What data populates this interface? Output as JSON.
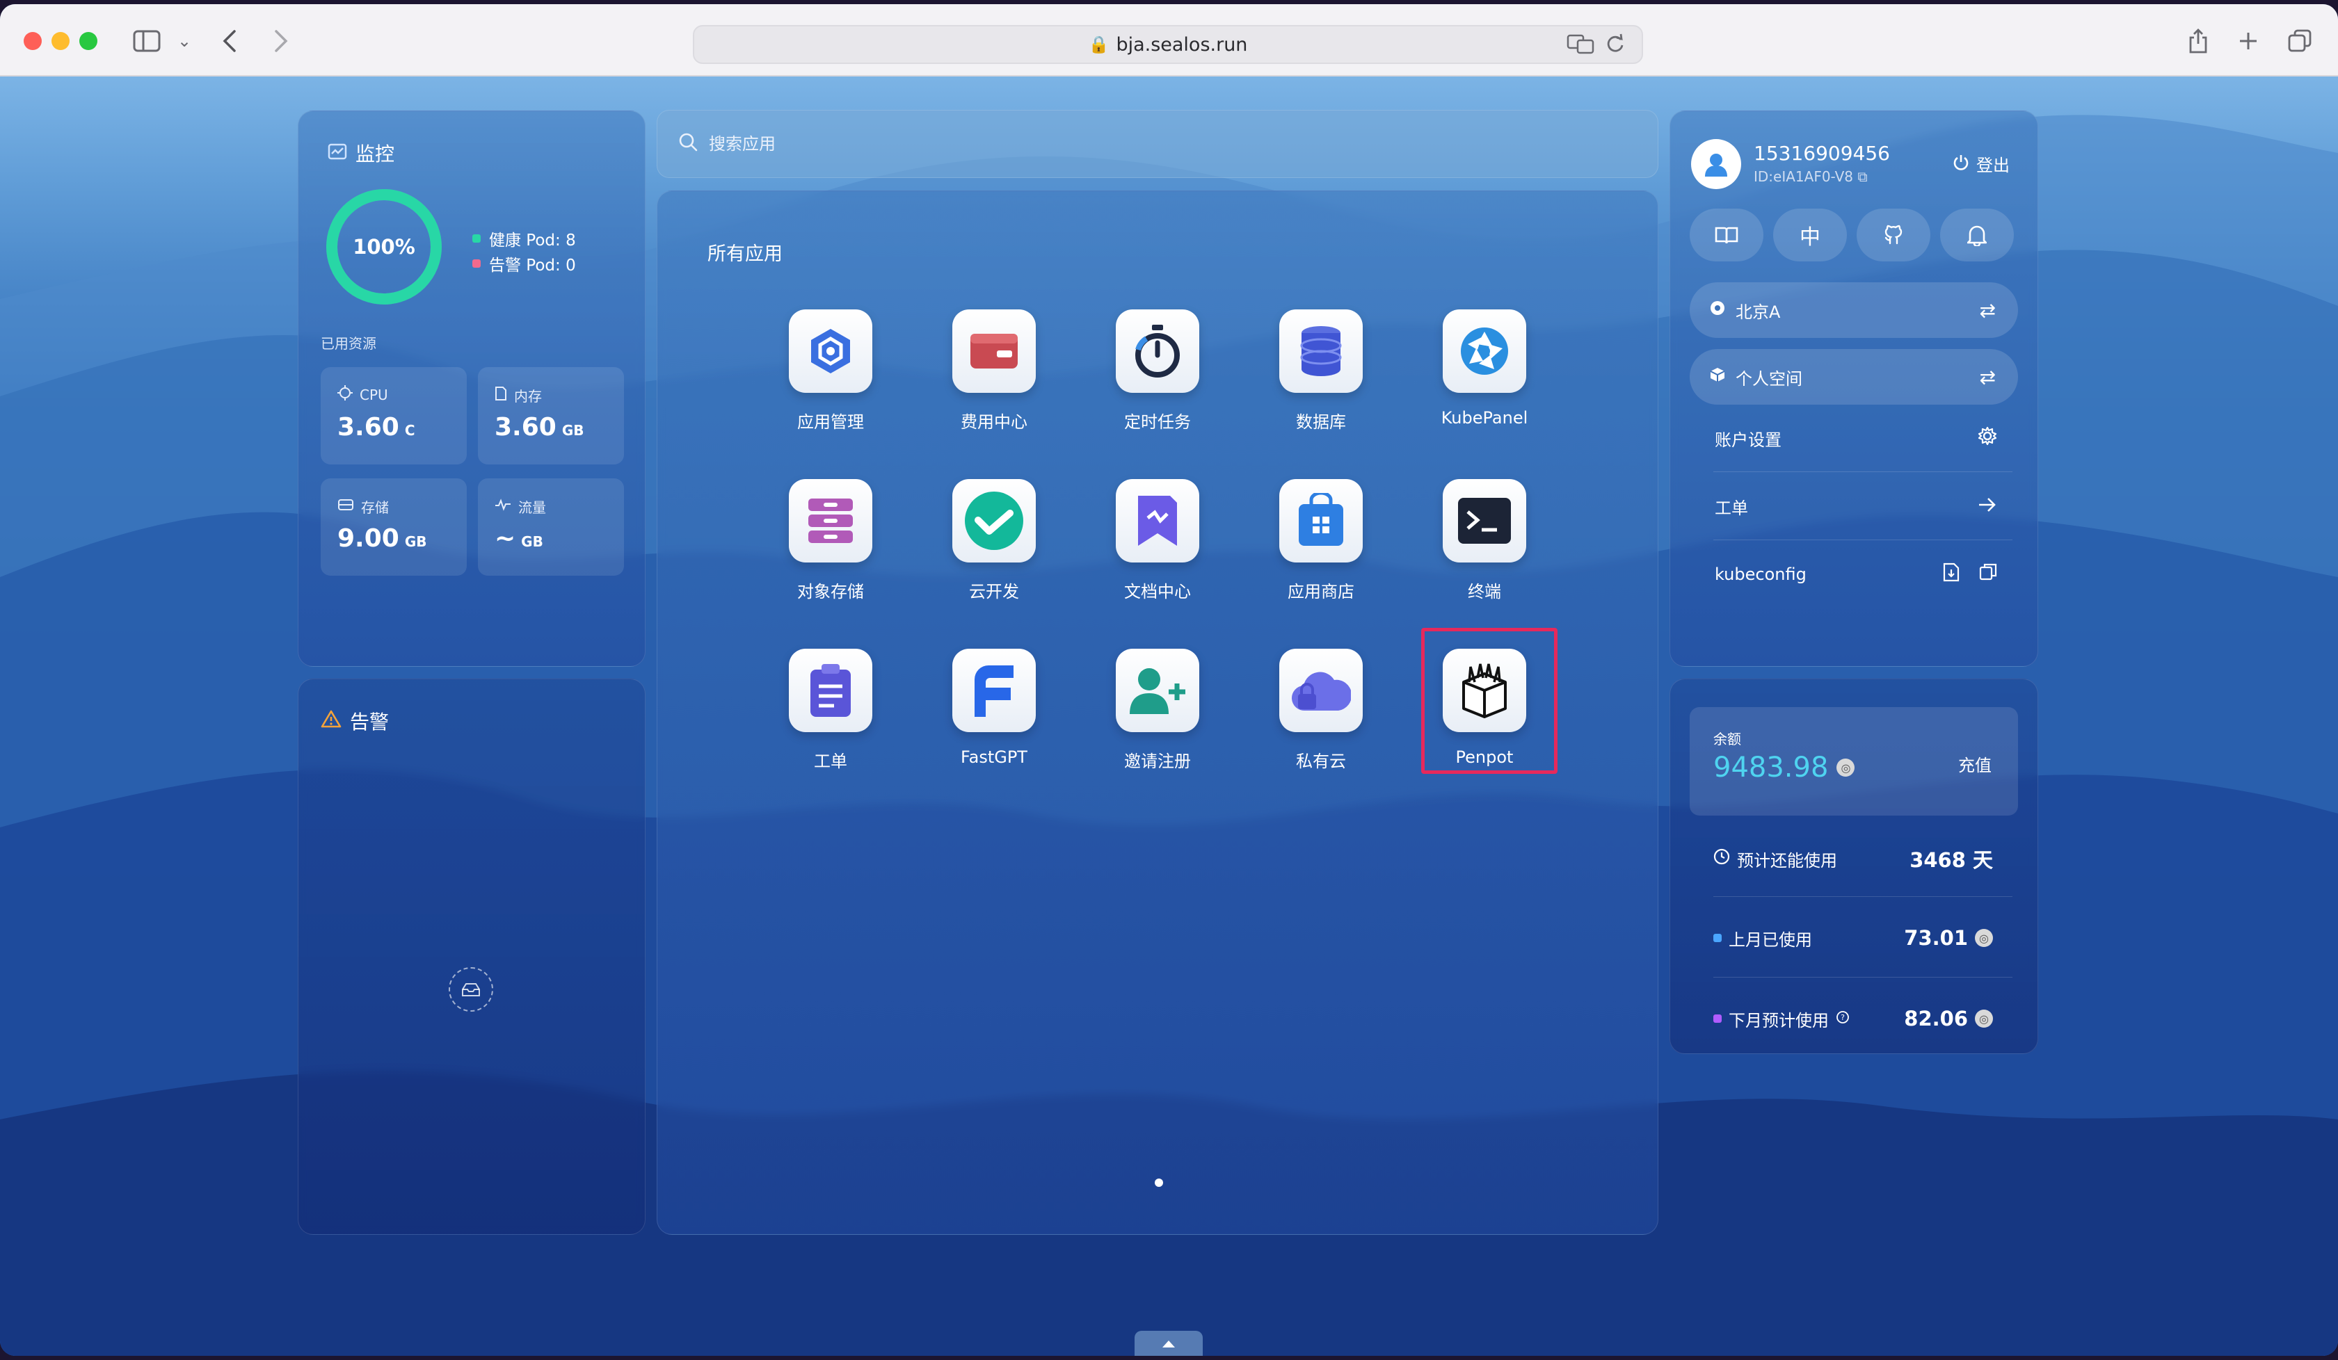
{
  "browser": {
    "url": "bja.sealos.run"
  },
  "monitor": {
    "title": "监控",
    "health_percent": "100%",
    "healthy_pod": "健康 Pod: 8",
    "alarm_pod": "告警 Pod: 0",
    "resources_title": "已用资源",
    "resources": [
      {
        "label": "CPU",
        "value": "3.60",
        "unit": "C"
      },
      {
        "label": "内存",
        "value": "3.60",
        "unit": "GB"
      },
      {
        "label": "存储",
        "value": "9.00",
        "unit": "GB"
      },
      {
        "label": "流量",
        "value": "~",
        "unit": "GB"
      }
    ],
    "colors": {
      "healthy": "#28d7a6",
      "alarm": "#f26a8d"
    }
  },
  "alarm": {
    "title": "告警"
  },
  "search": {
    "placeholder": "搜索应用"
  },
  "apps": {
    "title": "所有应用",
    "items": [
      {
        "label": "应用管理",
        "icon": "hexagon-app-icon"
      },
      {
        "label": "费用中心",
        "icon": "wallet-icon"
      },
      {
        "label": "定时任务",
        "icon": "stopwatch-icon"
      },
      {
        "label": "数据库",
        "icon": "database-icon"
      },
      {
        "label": "KubePanel",
        "icon": "aperture-icon"
      },
      {
        "label": "对象存储",
        "icon": "storage-box-icon"
      },
      {
        "label": "云开发",
        "icon": "cloud-dev-icon"
      },
      {
        "label": "文档中心",
        "icon": "document-icon"
      },
      {
        "label": "应用商店",
        "icon": "store-bag-icon"
      },
      {
        "label": "终端",
        "icon": "terminal-icon"
      },
      {
        "label": "工单",
        "icon": "clipboard-icon"
      },
      {
        "label": "FastGPT",
        "icon": "fastgpt-icon"
      },
      {
        "label": "邀请注册",
        "icon": "add-user-icon"
      },
      {
        "label": "私有云",
        "icon": "private-cloud-icon"
      },
      {
        "label": "Penpot",
        "icon": "penpot-icon"
      }
    ],
    "selected": "Penpot"
  },
  "account": {
    "phone": "15316909456",
    "id": "ID:eIA1AF0-V8",
    "logout": "登出",
    "quick_lang": "中",
    "region": "北京A",
    "workspace": "个人空间",
    "menu": [
      {
        "label": "账户设置"
      },
      {
        "label": "工单"
      },
      {
        "label": "kubeconfig"
      }
    ]
  },
  "balance": {
    "label": "余额",
    "value": "9483.98",
    "recharge": "充值",
    "remaining_label": "预计还能使用",
    "remaining_value": "3468 天",
    "last_month_label": "上月已使用",
    "last_month_value": "73.01",
    "next_month_label": "下月预计使用",
    "next_month_value": "82.06",
    "colors": {
      "accent": "#4fd4f0",
      "last_month": "#4aa6ff",
      "next_month": "#b05cff"
    }
  }
}
